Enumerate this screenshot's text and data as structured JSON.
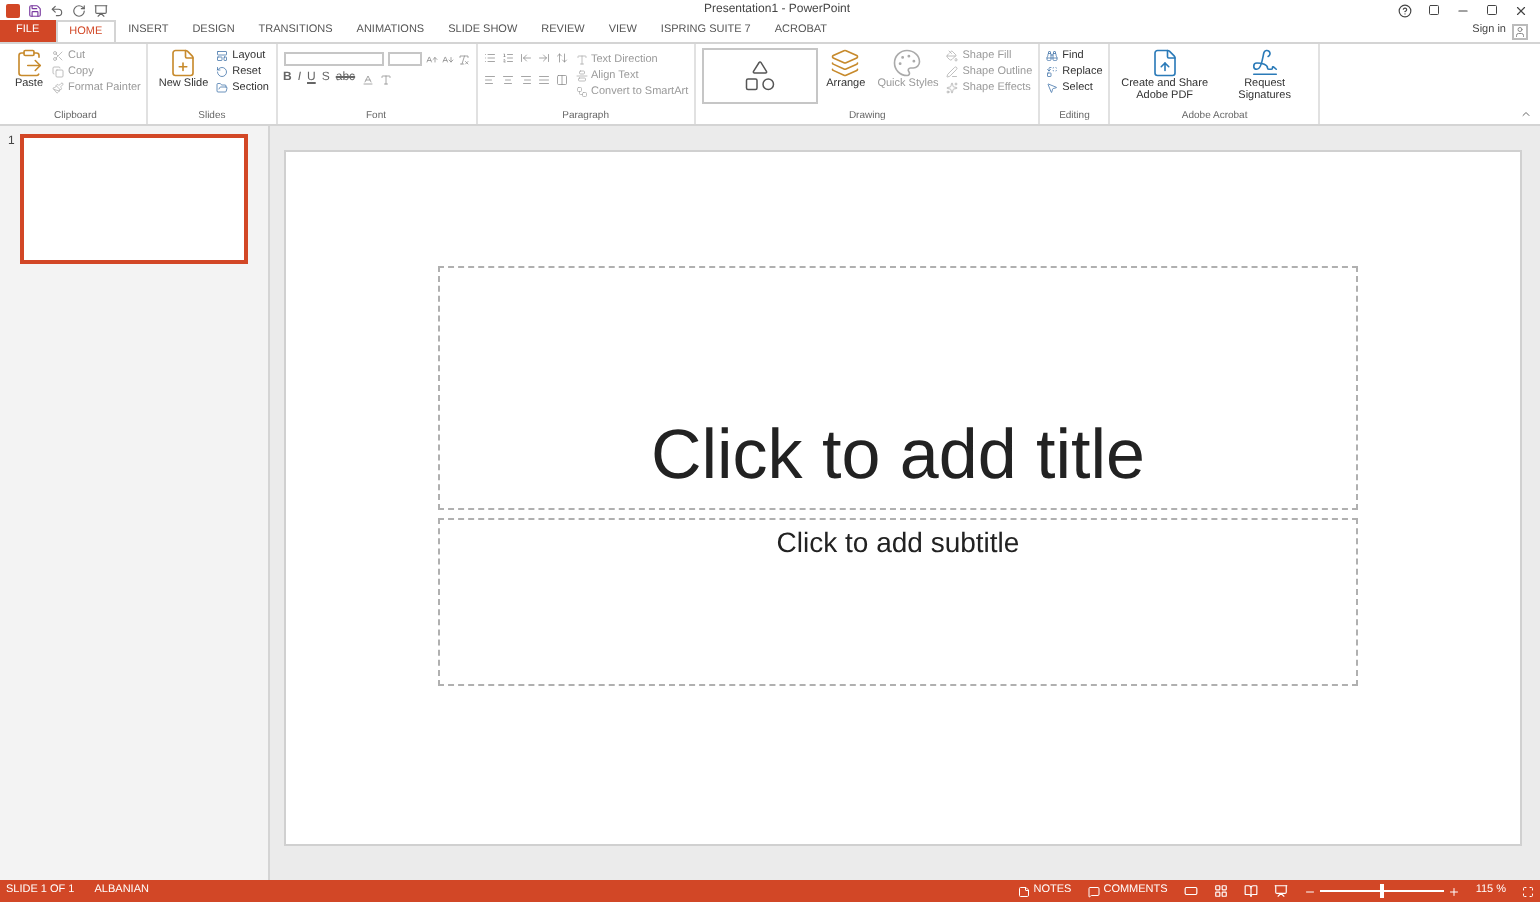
{
  "window": {
    "title": "Presentation1 - PowerPoint"
  },
  "tabs": [
    {
      "label": "FILE",
      "kind": "file",
      "selected": false
    },
    {
      "label": "HOME",
      "kind": "tab",
      "selected": true
    },
    {
      "label": "INSERT",
      "kind": "tab",
      "selected": false
    },
    {
      "label": "DESIGN",
      "kind": "tab",
      "selected": false
    },
    {
      "label": "TRANSITIONS",
      "kind": "tab",
      "selected": false
    },
    {
      "label": "ANIMATIONS",
      "kind": "tab",
      "selected": false
    },
    {
      "label": "SLIDE SHOW",
      "kind": "tab",
      "selected": false
    },
    {
      "label": "REVIEW",
      "kind": "tab",
      "selected": false
    },
    {
      "label": "VIEW",
      "kind": "tab",
      "selected": false
    },
    {
      "label": "ISPRING SUITE 7",
      "kind": "tab",
      "selected": false
    },
    {
      "label": "ACROBAT",
      "kind": "tab",
      "selected": false
    }
  ],
  "account": {
    "sign_in": "Sign in"
  },
  "ribbon": {
    "groups": [
      {
        "label": "Clipboard",
        "kind": "standard",
        "large": [
          {
            "label": "Paste",
            "disabled": false
          }
        ],
        "small": [
          {
            "label": "Cut",
            "disabled": true
          },
          {
            "label": "Copy",
            "disabled": true
          },
          {
            "label": "Format Painter",
            "disabled": true
          }
        ]
      },
      {
        "label": "Slides",
        "kind": "standard",
        "large": [
          {
            "label": "New Slide",
            "disabled": false
          }
        ],
        "small": [
          {
            "label": "Layout",
            "disabled": false
          },
          {
            "label": "Reset",
            "disabled": false
          },
          {
            "label": "Section",
            "disabled": false
          }
        ]
      },
      {
        "label": "Font",
        "kind": "font",
        "glyphs": [
          "B",
          "I",
          "U",
          "S",
          "abc"
        ]
      },
      {
        "label": "Paragraph",
        "kind": "paragraph",
        "small": [
          {
            "label": "Text Direction",
            "disabled": true
          },
          {
            "label": "Align Text",
            "disabled": true
          },
          {
            "label": "Convert to SmartArt",
            "disabled": true
          }
        ]
      },
      {
        "label": "Drawing",
        "kind": "drawing",
        "large": [
          {
            "label": "Arrange",
            "disabled": false
          },
          {
            "label": "Quick Styles",
            "disabled": true
          }
        ],
        "small": [
          {
            "label": "Shape Fill",
            "disabled": true
          },
          {
            "label": "Shape Outline",
            "disabled": true
          },
          {
            "label": "Shape Effects",
            "disabled": true
          }
        ]
      },
      {
        "label": "Editing",
        "kind": "standard",
        "small": [
          {
            "label": "Find",
            "disabled": false
          },
          {
            "label": "Replace",
            "disabled": false
          },
          {
            "label": "Select",
            "disabled": false
          }
        ]
      },
      {
        "label": "Adobe Acrobat",
        "kind": "standard",
        "large": [
          {
            "label": "Create and Share Adobe PDF",
            "disabled": false
          },
          {
            "label": "Request Signatures",
            "disabled": false
          }
        ]
      }
    ]
  },
  "thumbnails": [
    {
      "number": "1",
      "selected": true
    }
  ],
  "slide": {
    "title_placeholder": "Click to add title",
    "subtitle_placeholder": "Click to add subtitle"
  },
  "status_bar": {
    "slide": "SLIDE 1 OF 1",
    "language": "ALBANIAN",
    "notes": "NOTES",
    "comments": "COMMENTS",
    "zoom": "115 %",
    "zoom_slider": {
      "level": 0.5
    }
  }
}
